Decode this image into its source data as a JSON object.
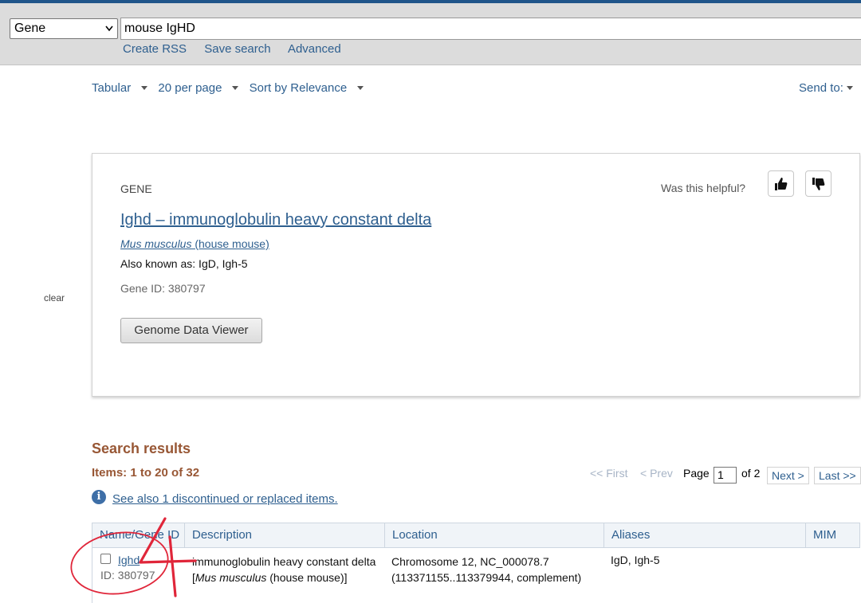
{
  "search": {
    "database": "Gene",
    "term": "mouse IgHD",
    "links": [
      "Create RSS",
      "Save search",
      "Advanced"
    ]
  },
  "display": {
    "format": "Tabular",
    "per_page": "20 per page",
    "sort": "Sort by Relevance",
    "send_to": "Send to:"
  },
  "sidebar": {
    "clear": "clear"
  },
  "gene_card": {
    "kind": "GENE",
    "helpful_prompt": "Was this helpful?",
    "title": "Ighd  –  immunoglobulin heavy constant delta",
    "organism_italic": "Mus musculus",
    "organism_common": " (house mouse)",
    "also_known": "Also known as: IgD, Igh-5",
    "gene_id": "Gene ID: 380797",
    "button": "Genome Data Viewer"
  },
  "results": {
    "heading": "Search results",
    "items": "Items: 1 to 20 of 32",
    "pager": {
      "first": "<< First",
      "prev": "< Prev",
      "page_label": "Page",
      "page_value": "1",
      "of": "of 2",
      "next": "Next >",
      "last": "Last >>"
    },
    "see_also": "See also 1 discontinued or replaced items.",
    "columns": [
      "Name/Gene ID",
      "Description",
      "Location",
      "Aliases",
      "MIM"
    ],
    "rows": [
      {
        "name": "Ighd",
        "id": "ID: 380797",
        "desc_1": "immunoglobulin heavy constant delta [",
        "desc_italic": "Mus musculus",
        "desc_2": " (house mouse)]",
        "location": "Chromosome 12, NC_000078.7 (113371155..113379944, complement)",
        "aliases": "IgD, Igh-5",
        "mim": ""
      }
    ]
  },
  "colors": {
    "link": "#2e5f8f",
    "heading": "#985735",
    "annotation": "#e0263a"
  },
  "icons": [
    "thumbs-up-icon",
    "thumbs-down-icon",
    "info-icon",
    "chevron-down-icon"
  ]
}
